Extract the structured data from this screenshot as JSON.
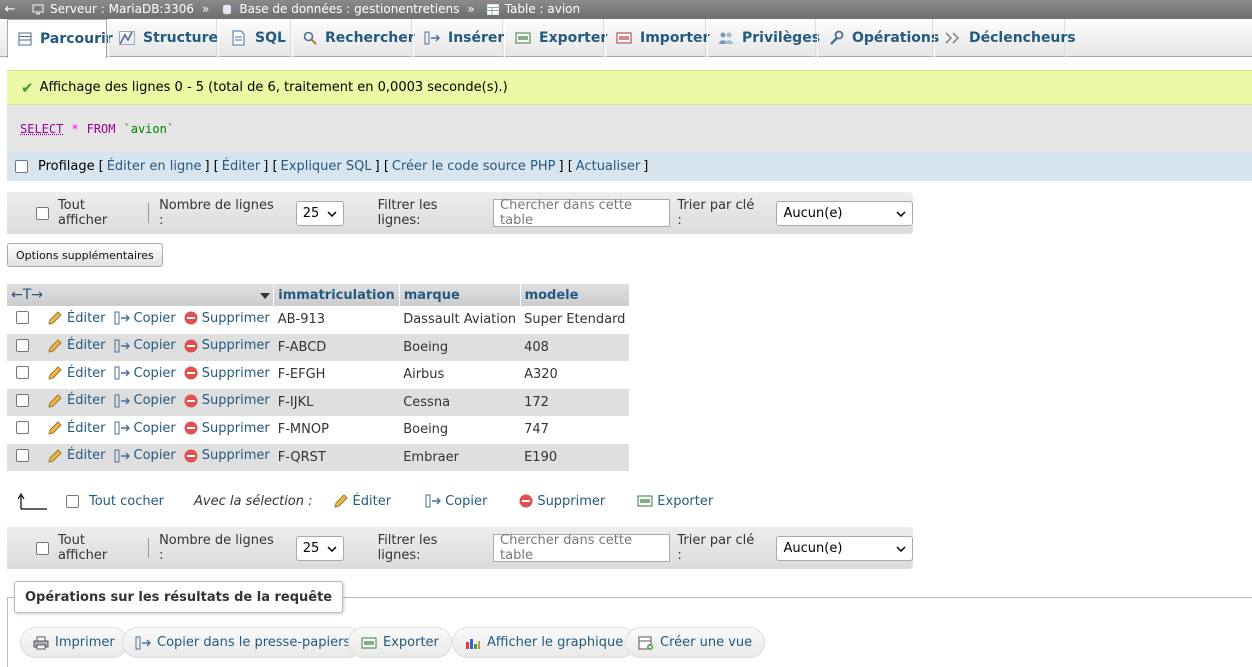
{
  "breadcrumb": {
    "back": "←",
    "server": "Serveur : MariaDB:3306",
    "database": "Base de données : gestionentretiens",
    "table": "Table : avion",
    "sep": "»"
  },
  "tabs": [
    {
      "label": "Parcourir",
      "icon": "browse-icon"
    },
    {
      "label": "Structure",
      "icon": "structure-icon"
    },
    {
      "label": "SQL",
      "icon": "sql-icon"
    },
    {
      "label": "Rechercher",
      "icon": "search-icon"
    },
    {
      "label": "Insérer",
      "icon": "insert-icon"
    },
    {
      "label": "Exporter",
      "icon": "export-icon"
    },
    {
      "label": "Importer",
      "icon": "import-icon"
    },
    {
      "label": "Privilèges",
      "icon": "privileges-icon"
    },
    {
      "label": "Opérations",
      "icon": "wrench-icon"
    },
    {
      "label": "Déclencheurs",
      "icon": "triggers-icon"
    }
  ],
  "message": "Affichage des lignes 0 - 5 (total de 6, traitement en 0,0003 seconde(s).)",
  "sql": {
    "select": "SELECT",
    "star": "*",
    "from": "FROM",
    "table": "`avion`"
  },
  "profiling": {
    "label": "Profilage",
    "links": [
      "Éditer en ligne",
      "Éditer",
      "Expliquer SQL",
      "Créer le code source PHP",
      "Actualiser"
    ]
  },
  "nav": {
    "show_all": "Tout afficher",
    "rows_label": "Nombre de lignes :",
    "rows_value": "25",
    "filter_label": "Filtrer les lignes:",
    "filter_placeholder": "Chercher dans cette table",
    "sort_label": "Trier par clé :",
    "sort_value": "Aucun(e)"
  },
  "extra_options": "Options supplémentaires",
  "table": {
    "columns": [
      "immatriculation",
      "marque",
      "modele"
    ],
    "actions": {
      "edit": "Éditer",
      "copy": "Copier",
      "delete": "Supprimer"
    },
    "rows": [
      {
        "immatriculation": "AB-913",
        "marque": "Dassault Aviation",
        "modele": "Super Etendard"
      },
      {
        "immatriculation": "F-ABCD",
        "marque": "Boeing",
        "modele": "408"
      },
      {
        "immatriculation": "F-EFGH",
        "marque": "Airbus",
        "modele": "A320"
      },
      {
        "immatriculation": "F-IJKL",
        "marque": "Cessna",
        "modele": "172"
      },
      {
        "immatriculation": "F-MNOP",
        "marque": "Boeing",
        "modele": "747"
      },
      {
        "immatriculation": "F-QRST",
        "marque": "Embraer",
        "modele": "E190"
      }
    ]
  },
  "selection": {
    "check_all": "Tout cocher",
    "with_selection": "Avec la sélection :",
    "edit": "Éditer",
    "copy": "Copier",
    "delete": "Supprimer",
    "export": "Exporter"
  },
  "query_ops": {
    "legend": "Opérations sur les résultats de la requête",
    "print": "Imprimer",
    "copy_clipboard": "Copier dans le presse-papiers",
    "export": "Exporter",
    "chart": "Afficher le graphique",
    "create_view": "Créer une vue"
  },
  "colors": {
    "link": "#235a81",
    "success_bg": "#ebf8a4",
    "sql_bg": "#e5e5e5",
    "profil_bg": "#d8e4ee"
  }
}
